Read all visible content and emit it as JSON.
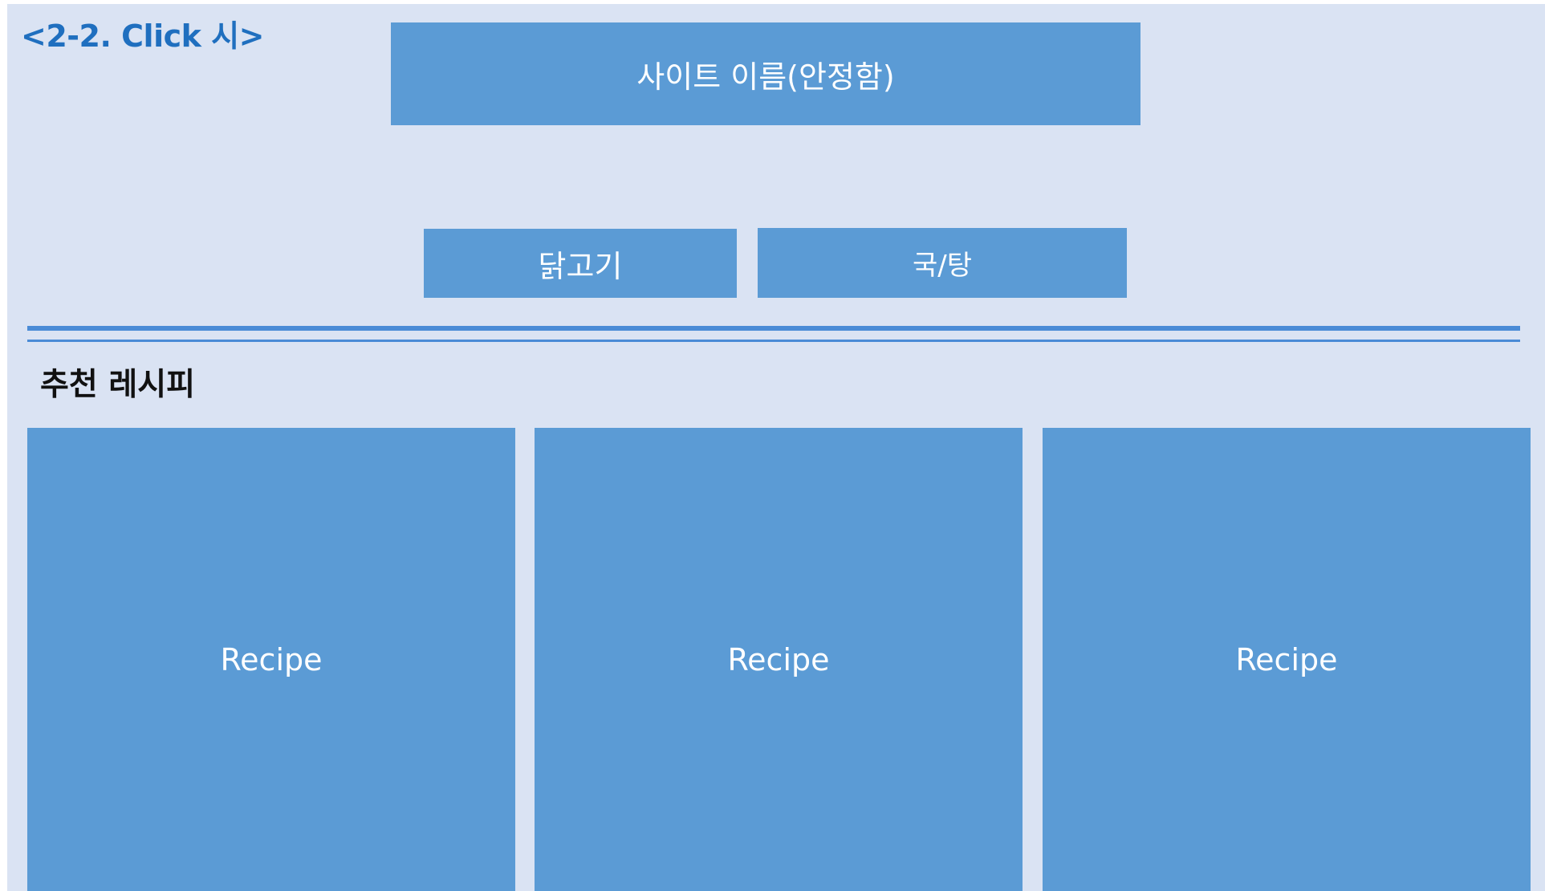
{
  "slide": {
    "title": "<2-2. Click 시>"
  },
  "header": {
    "site_name": "사이트 이름(안정함)"
  },
  "categories": [
    {
      "label": "닭고기"
    },
    {
      "label": "국/탕"
    }
  ],
  "recommended": {
    "heading": "추천 레시피",
    "recipes": [
      {
        "label": "Recipe"
      },
      {
        "label": "Recipe"
      },
      {
        "label": "Recipe"
      }
    ]
  },
  "colors": {
    "background": "#dae3f3",
    "block": "#5b9bd5",
    "title_text": "#1f6fbf",
    "rule": "#4a8bd6"
  }
}
